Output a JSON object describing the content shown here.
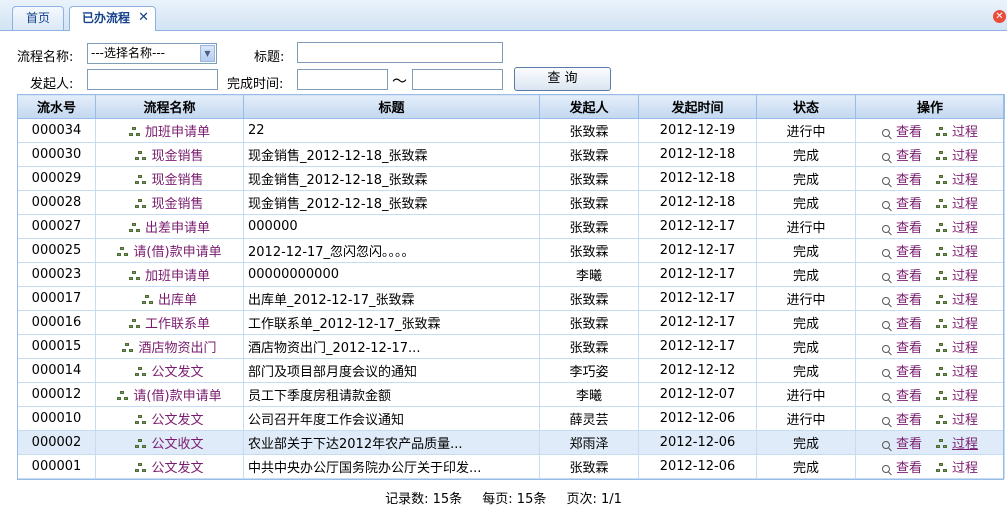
{
  "tabs": [
    {
      "label": "首页"
    },
    {
      "label": "已办流程",
      "close": "✕"
    }
  ],
  "filters": {
    "flow_name_label": "流程名称:",
    "flow_name_value": "---选择名称---",
    "title_label": "标题:",
    "initiator_label": "发起人:",
    "finish_time_label": "完成时间:",
    "range_sep": "〜",
    "search_button": "查 询"
  },
  "table": {
    "columns": [
      "流水号",
      "流程名称",
      "标题",
      "发起人",
      "发起时间",
      "状态",
      "操作"
    ],
    "view_label": "查看",
    "process_label": "过程",
    "rows": [
      {
        "id": "000034",
        "flow": "加班申请单",
        "title": "22",
        "initiator": "张致霖",
        "time": "2012-12-19",
        "status": "进行中"
      },
      {
        "id": "000030",
        "flow": "现金销售",
        "title": "现金销售_2012-12-18_张致霖",
        "initiator": "张致霖",
        "time": "2012-12-18",
        "status": "完成"
      },
      {
        "id": "000029",
        "flow": "现金销售",
        "title": "现金销售_2012-12-18_张致霖",
        "initiator": "张致霖",
        "time": "2012-12-18",
        "status": "完成"
      },
      {
        "id": "000028",
        "flow": "现金销售",
        "title": "现金销售_2012-12-18_张致霖",
        "initiator": "张致霖",
        "time": "2012-12-18",
        "status": "完成"
      },
      {
        "id": "000027",
        "flow": "出差申请单",
        "title": "000000",
        "initiator": "张致霖",
        "time": "2012-12-17",
        "status": "进行中"
      },
      {
        "id": "000025",
        "flow": "请(借)款申请单",
        "title": "2012-12-17_忽闪忽闪。。。。",
        "initiator": "张致霖",
        "time": "2012-12-17",
        "status": "完成"
      },
      {
        "id": "000023",
        "flow": "加班申请单",
        "title": "00000000000",
        "initiator": "李曦",
        "time": "2012-12-17",
        "status": "完成"
      },
      {
        "id": "000017",
        "flow": "出库单",
        "title": "出库单_2012-12-17_张致霖",
        "initiator": "张致霖",
        "time": "2012-12-17",
        "status": "进行中"
      },
      {
        "id": "000016",
        "flow": "工作联系单",
        "title": "工作联系单_2012-12-17_张致霖",
        "initiator": "张致霖",
        "time": "2012-12-17",
        "status": "完成"
      },
      {
        "id": "000015",
        "flow": "酒店物资出门",
        "title": "酒店物资出门_2012-12-17...",
        "initiator": "张致霖",
        "time": "2012-12-17",
        "status": "完成"
      },
      {
        "id": "000014",
        "flow": "公文发文",
        "title": "部门及项目部月度会议的通知",
        "initiator": "李巧姿",
        "time": "2012-12-12",
        "status": "完成"
      },
      {
        "id": "000012",
        "flow": "请(借)款申请单",
        "title": "员工下季度房租请款金额",
        "initiator": "李曦",
        "time": "2012-12-07",
        "status": "进行中"
      },
      {
        "id": "000010",
        "flow": "公文发文",
        "title": "公司召开年度工作会议通知",
        "initiator": "薛灵芸",
        "time": "2012-12-06",
        "status": "进行中"
      },
      {
        "id": "000002",
        "flow": "公文收文",
        "title": "农业部关于下达2012年农产品质量...",
        "initiator": "郑雨泽",
        "time": "2012-12-06",
        "status": "完成"
      },
      {
        "id": "000001",
        "flow": "公文发文",
        "title": "中共中央办公厅国务院办公厅关于印发...",
        "initiator": "张致霖",
        "time": "2012-12-06",
        "status": "完成"
      }
    ]
  },
  "footer": {
    "records": "记录数: 15条",
    "per_page": "每页: 15条",
    "pages": "页次: 1/1"
  }
}
